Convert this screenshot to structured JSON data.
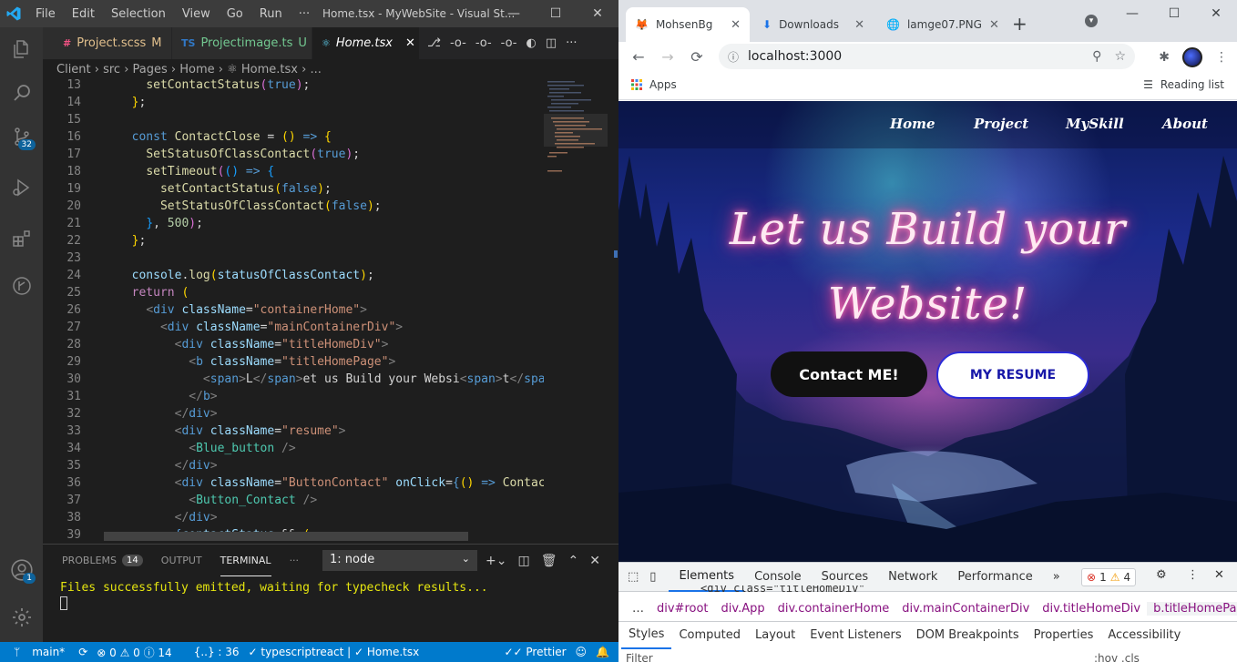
{
  "vscode": {
    "menu": [
      "File",
      "Edit",
      "Selection",
      "View",
      "Go",
      "Run",
      "···"
    ],
    "window_title": "Home.tsx - MyWebSite - Visual St...",
    "window_controls": {
      "minimize": "—",
      "maximize": "☐",
      "close": "✕"
    },
    "activity_badges": {
      "source_control": "32",
      "accounts": "1"
    },
    "tabs": [
      {
        "icon": "#",
        "label": "Project.scss",
        "suffix": "M",
        "color": "#e2c08d"
      },
      {
        "icon": "TS",
        "label": "Projectimage.ts",
        "suffix": "U",
        "color": "#73c991"
      },
      {
        "icon": "⚛",
        "label": "Home.tsx",
        "suffix": "✕",
        "color": "#ffffff"
      }
    ],
    "breadcrumb": "Client  ›  src  ›  Pages  ›  Home  ›  ⚛ Home.tsx  ›  ...",
    "code_lines": [
      {
        "n": "13",
        "html": "    <span class='fn'>setContactStatus</span><span class='pk'>(</span><span class='k'>true</span><span class='pk'>)</span><span class='p'>;</span>"
      },
      {
        "n": "14",
        "html": "  <span class='y'>}</span><span class='p'>;</span>"
      },
      {
        "n": "15",
        "html": ""
      },
      {
        "n": "16",
        "html": "  <span class='k'>const</span> <span class='fn'>ContactClose</span> <span class='p'>=</span> <span class='y'>()</span> <span class='k'>=&gt;</span> <span class='y'>{</span>"
      },
      {
        "n": "17",
        "html": "    <span class='fn'>SetStatusOfClassContact</span><span class='pk'>(</span><span class='k'>true</span><span class='pk'>)</span><span class='p'>;</span>"
      },
      {
        "n": "18",
        "html": "    <span class='fn'>setTimeout</span><span class='pk'>(</span><span class='bl'>()</span> <span class='k'>=&gt;</span> <span class='bl'>{</span>"
      },
      {
        "n": "19",
        "html": "      <span class='fn'>setContactStatus</span><span class='y'>(</span><span class='k'>false</span><span class='y'>)</span><span class='p'>;</span>"
      },
      {
        "n": "20",
        "html": "      <span class='fn'>SetStatusOfClassContact</span><span class='y'>(</span><span class='k'>false</span><span class='y'>)</span><span class='p'>;</span>"
      },
      {
        "n": "21",
        "html": "    <span class='bl'>}</span><span class='p'>, </span><span class='n'>500</span><span class='pk'>)</span><span class='p'>;</span>"
      },
      {
        "n": "22",
        "html": "  <span class='y'>}</span><span class='p'>;</span>"
      },
      {
        "n": "23",
        "html": ""
      },
      {
        "n": "24",
        "html": "  <span class='v'>console</span><span class='p'>.</span><span class='fn'>log</span><span class='y'>(</span><span class='v'>statusOfClassContact</span><span class='y'>)</span><span class='p'>;</span>"
      },
      {
        "n": "25",
        "html": "  <span class='kc'>return</span> <span class='y'>(</span>"
      },
      {
        "n": "26",
        "html": "    <span class='tg'>&lt;</span><span class='t'>div</span> <span class='v'>className</span><span class='p'>=</span><span class='s'>\"containerHome\"</span><span class='tg'>&gt;</span>"
      },
      {
        "n": "27",
        "html": "      <span class='tg'>&lt;</span><span class='t'>div</span> <span class='v'>className</span><span class='p'>=</span><span class='s'>\"mainContainerDiv\"</span><span class='tg'>&gt;</span>"
      },
      {
        "n": "28",
        "html": "        <span class='tg'>&lt;</span><span class='t'>div</span> <span class='v'>className</span><span class='p'>=</span><span class='s'>\"titleHomeDiv\"</span><span class='tg'>&gt;</span>"
      },
      {
        "n": "29",
        "html": "          <span class='tg'>&lt;</span><span class='t'>b</span> <span class='v'>className</span><span class='p'>=</span><span class='s'>\"titleHomePage\"</span><span class='tg'>&gt;</span>"
      },
      {
        "n": "30",
        "html": "            <span class='tg'>&lt;</span><span class='t'>span</span><span class='tg'>&gt;</span><span class='p'>L</span><span class='tg'>&lt;/</span><span class='t'>span</span><span class='tg'>&gt;</span><span class='p'>et us Build your Websi</span><span class='tg'>&lt;</span><span class='t'>span</span><span class='tg'>&gt;</span><span class='p'>t</span><span class='tg'>&lt;/</span><span class='t'>span</span><span class='tg'>&gt;</span><span class='p'>e</span>"
      },
      {
        "n": "31",
        "html": "          <span class='tg'>&lt;/</span><span class='t'>b</span><span class='tg'>&gt;</span>"
      },
      {
        "n": "32",
        "html": "        <span class='tg'>&lt;/</span><span class='t'>div</span><span class='tg'>&gt;</span>"
      },
      {
        "n": "33",
        "html": "        <span class='tg'>&lt;</span><span class='t'>div</span> <span class='v'>className</span><span class='p'>=</span><span class='s'>\"resume\"</span><span class='tg'>&gt;</span>"
      },
      {
        "n": "34",
        "html": "          <span class='tg'>&lt;</span><span class='c4'>Blue_button</span> <span class='tg'>/&gt;</span>"
      },
      {
        "n": "35",
        "html": "        <span class='tg'>&lt;/</span><span class='t'>div</span><span class='tg'>&gt;</span>"
      },
      {
        "n": "36",
        "html": "        <span class='tg'>&lt;</span><span class='t'>div</span> <span class='v'>className</span><span class='p'>=</span><span class='s'>\"ButtonContact\"</span> <span class='v'>onClick</span><span class='p'>=</span><span class='k'>{</span><span class='y'>()</span> <span class='k'>=&gt;</span> <span class='fn'>ContactOr</span>"
      },
      {
        "n": "37",
        "html": "          <span class='tg'>&lt;</span><span class='c4'>Button_Contact</span> <span class='tg'>/&gt;</span>"
      },
      {
        "n": "38",
        "html": "        <span class='tg'>&lt;/</span><span class='t'>div</span><span class='tg'>&gt;</span>"
      },
      {
        "n": "39",
        "html": "        <span class='k'>{</span><span class='v'>contactStatus</span> <span class='p'>&amp;&amp;</span> <span class='y'>(</span>"
      }
    ],
    "panel": {
      "tabs": [
        {
          "label": "PROBLEMS",
          "badge": "14"
        },
        {
          "label": "OUTPUT",
          "badge": ""
        },
        {
          "label": "TERMINAL",
          "badge": ""
        },
        {
          "label": "···",
          "badge": ""
        }
      ],
      "terminal_select": "1: node",
      "terminal_output": "Files successfully emitted, waiting for typecheck results..."
    },
    "status": {
      "branch": "main*",
      "problems": "⊗ 0 ⚠ 0 ⓘ 14",
      "braces": "{..} : 36",
      "language": "✓ typescriptreact | ✓ Home.tsx",
      "prettier": "✓✓ Prettier"
    }
  },
  "chrome": {
    "tabs": [
      {
        "label": "MohsenBg",
        "icon": "fox"
      },
      {
        "label": "Downloads",
        "icon": "download"
      },
      {
        "label": "lamge07.PNG",
        "icon": "globe"
      }
    ],
    "new_tab": "+",
    "url": "localhost:3000",
    "bookmarks": {
      "apps": "Apps",
      "reading_list": "Reading list"
    },
    "site": {
      "nav": [
        "Home",
        "Project",
        "MySkill",
        "About"
      ],
      "title_line1": "Let us Build your",
      "title_line2": "Website!",
      "btn_contact": "Contact ME!",
      "btn_resume": "MY RESUME"
    },
    "devtools": {
      "tabs": [
        "Elements",
        "Console",
        "Sources",
        "Network",
        "Performance",
        "»"
      ],
      "errors": "1",
      "warnings": "4",
      "dom_line": "<div class=\"titleHomeDiv\"",
      "crumbs": [
        "…",
        "div#root",
        "div.App",
        "div.containerHome",
        "div.mainContainerDiv",
        "div.titleHomeDiv",
        "b.titleHomePage"
      ],
      "style_tabs": [
        "Styles",
        "Computed",
        "Layout",
        "Event Listeners",
        "DOM Breakpoints",
        "Properties",
        "Accessibility"
      ],
      "filter_placeholder": "Filter",
      "filter_right": ":hov  .cls"
    }
  }
}
